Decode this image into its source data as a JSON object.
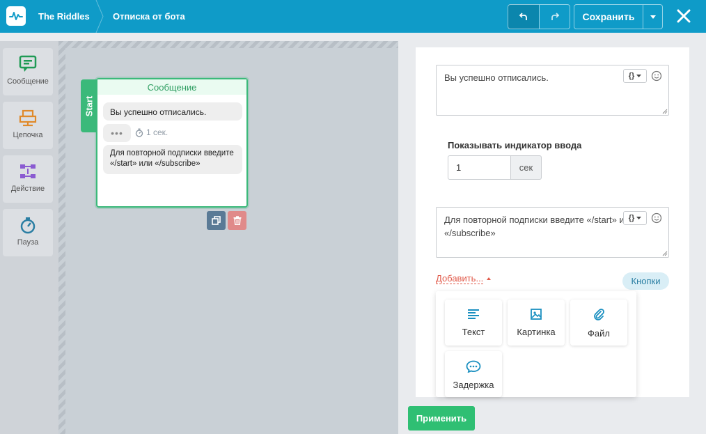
{
  "header": {
    "project": "The Riddles",
    "page": "Отписка от бота",
    "save_label": "Сохранить"
  },
  "sidebar": {
    "items": [
      {
        "label": "Сообщение",
        "icon": "message-icon",
        "color": "#1f9a55"
      },
      {
        "label": "Цепочка",
        "icon": "chain-icon",
        "color": "#e08a2a"
      },
      {
        "label": "Действие",
        "icon": "action-icon",
        "color": "#8a5bd1"
      },
      {
        "label": "Пауза",
        "icon": "stopwatch-icon",
        "color": "#2a7ea3"
      }
    ]
  },
  "canvas": {
    "start_label": "Start",
    "node": {
      "title": "Сообщение",
      "message1": "Вы успешно отписались.",
      "typing": "•••",
      "delay": "1 сек.",
      "message2": "Для повторной подписки введите «/start» или «/subscribe»"
    }
  },
  "editor": {
    "text1": "Вы успешно отписались.",
    "typing_label": "Показывать индикатор ввода",
    "typing_value": "1",
    "typing_unit": "сек",
    "text2": "Для повторной подписки введите «/start» или «/subscribe»",
    "add_label": "Добавить...",
    "buttons_label": "Кнопки",
    "var_symbol": "{}",
    "menu": [
      {
        "label": "Текст",
        "icon": "text-lines-icon"
      },
      {
        "label": "Картинка",
        "icon": "image-icon"
      },
      {
        "label": "Файл",
        "icon": "paperclip-icon"
      },
      {
        "label": "Задержка",
        "icon": "typing-bubble-icon"
      }
    ],
    "apply_label": "Применить"
  },
  "colors": {
    "header": "#0f9bc8",
    "accent_green": "#3bb97a",
    "apply_green": "#2fbf73",
    "link_red": "#e15a4a"
  }
}
